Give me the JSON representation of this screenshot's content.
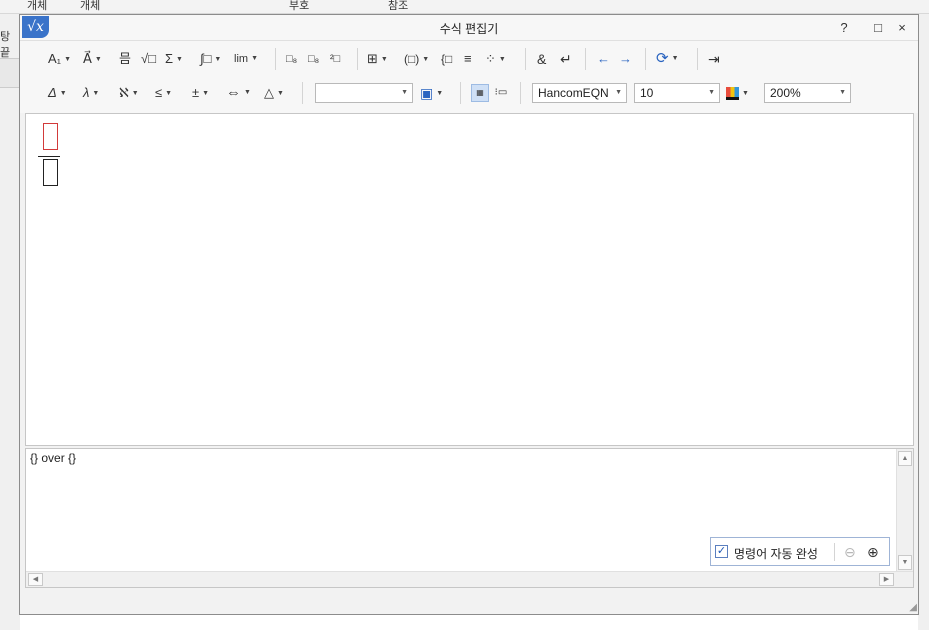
{
  "host": {
    "ribbon": [
      "개체",
      "개체",
      "부호",
      "참조"
    ],
    "left_tab": "탕끝"
  },
  "dialog": {
    "icon_glyph": "√x",
    "title": "수식 편집기",
    "help_label": "?",
    "maximize_glyph": "□",
    "close_glyph": "×"
  },
  "toolbar": {
    "row1": {
      "format_glyph": "A₁",
      "decorate_glyph": "A⃗",
      "fraction_glyph": "믐",
      "root_glyph": "√□",
      "sum_glyph": "Σ",
      "integral_glyph": "∫□",
      "limit_glyph": "lim",
      "subscript1_glyph": "□₈",
      "subscript2_glyph": "□₈",
      "subscript3_glyph": "²□",
      "matrix_glyph": "⊞",
      "paren_glyph": "(□)",
      "cases_glyph": "{□",
      "align_glyph": "≡",
      "grid_glyph": "⁘",
      "ampersand_glyph": "&",
      "newline_glyph": "↵",
      "left_arrow_glyph": "←",
      "right_arrow_glyph": "→",
      "refresh_glyph": "⟳",
      "exit_glyph": "⇥"
    },
    "row2": {
      "greek_upper_glyph": "Δ",
      "greek_lower_glyph": "λ",
      "hebrew_glyph": "ℵ",
      "relation_glyph": "≤",
      "operator_glyph": "±",
      "arrow_glyph": "⇔",
      "misc_glyph": "△",
      "style_value": "",
      "font_value": "HancomEQN",
      "size_value": "10",
      "zoom_value": "200%"
    }
  },
  "script": {
    "text": "{} over {}"
  },
  "autocomplete": {
    "checked_glyph": "✓",
    "label": "명령어 자동 완성",
    "zoom_out_glyph": "⊖",
    "zoom_in_glyph": "⊕"
  },
  "colors": {
    "accent": "#3a73c9",
    "placeholder_active": "#d23a3a"
  }
}
